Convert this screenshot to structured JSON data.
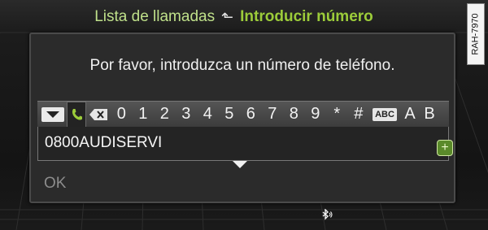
{
  "header": {
    "previous": "Lista de llamadas",
    "current": "Introducir número"
  },
  "figure_tag": "RAH-7970",
  "dialog": {
    "prompt": "Por favor, introduzca un número de teléfono.",
    "keys": {
      "digits": [
        "0",
        "1",
        "2",
        "3",
        "4",
        "5",
        "6",
        "7",
        "8",
        "9",
        "*",
        "#"
      ],
      "abc_label": "ABC",
      "letters": [
        "A",
        "B"
      ]
    },
    "input_value": "0800AUDISERVI",
    "ok_label": "OK"
  },
  "status": {
    "bluetooth_icon": "bluetooth-icon"
  },
  "colors": {
    "accent": "#9ccc3a",
    "breadcrumb": "#bfe08a"
  }
}
